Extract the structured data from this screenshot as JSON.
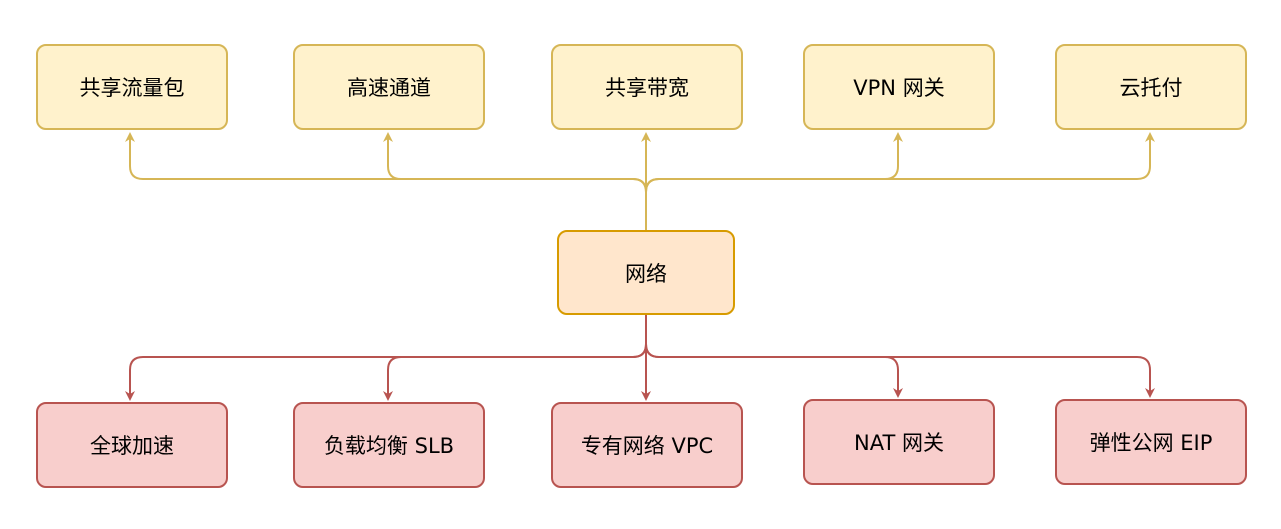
{
  "center": {
    "label": "网络"
  },
  "top_nodes": [
    {
      "label": "共享流量包"
    },
    {
      "label": "高速通道"
    },
    {
      "label": "共享带宽"
    },
    {
      "label": "VPN 网关"
    },
    {
      "label": "云托付"
    }
  ],
  "bottom_nodes": [
    {
      "label": "全球加速"
    },
    {
      "label": "负载均衡 SLB"
    },
    {
      "label": "专有网络 VPC"
    },
    {
      "label": "NAT 网关"
    },
    {
      "label": "弹性公网 EIP"
    }
  ],
  "colors": {
    "top_fill": "#fff2cc",
    "top_stroke": "#d6b656",
    "center_fill": "#ffe6cc",
    "center_stroke": "#d79b00",
    "bottom_fill": "#f8cecc",
    "bottom_stroke": "#b85450"
  }
}
